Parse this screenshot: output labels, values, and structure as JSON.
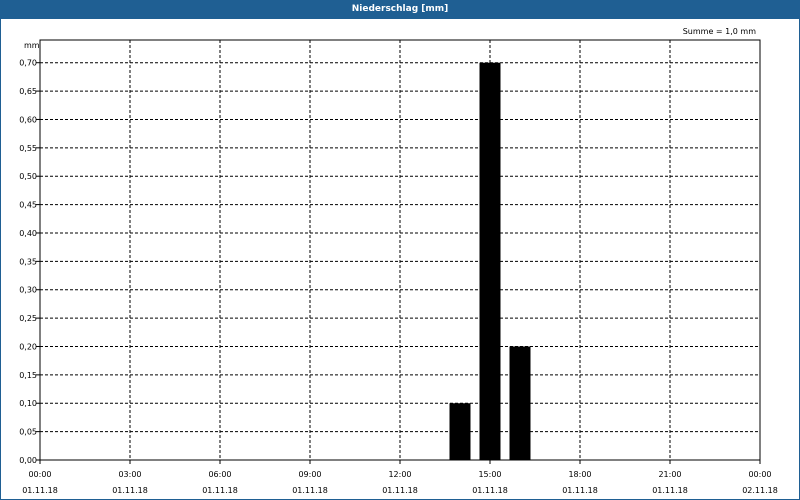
{
  "window": {
    "title": "Niederschlag [mm]"
  },
  "summary": {
    "text": "Summe = 1,0 mm"
  },
  "colors": {
    "titlebar": "#1f5f93",
    "bars": "#000000",
    "grid": "#000000"
  },
  "chart_data": {
    "type": "bar",
    "title": "Niederschlag [mm]",
    "ylabel": "mm",
    "ylim": [
      0,
      0.74
    ],
    "yticks": [
      0,
      0.05,
      0.1,
      0.15,
      0.2,
      0.25,
      0.3,
      0.35,
      0.4,
      0.45,
      0.5,
      0.55,
      0.6,
      0.65,
      0.7
    ],
    "ytick_labels": [
      "0,00",
      "0,05",
      "0,10",
      "0,15",
      "0,20",
      "0,25",
      "0,30",
      "0,35",
      "0,40",
      "0,45",
      "0,50",
      "0,55",
      "0,60",
      "0,65",
      "0,70"
    ],
    "xlim": [
      "01.11.18 00:00",
      "02.11.18 00:00"
    ],
    "x_ticks": [
      {
        "time": "00:00",
        "date": "01.11.18"
      },
      {
        "time": "03:00",
        "date": "01.11.18"
      },
      {
        "time": "06:00",
        "date": "01.11.18"
      },
      {
        "time": "09:00",
        "date": "01.11.18"
      },
      {
        "time": "12:00",
        "date": "01.11.18"
      },
      {
        "time": "15:00",
        "date": "01.11.18"
      },
      {
        "time": "18:00",
        "date": "01.11.18"
      },
      {
        "time": "21:00",
        "date": "01.11.18"
      },
      {
        "time": "00:00",
        "date": "02.11.18"
      }
    ],
    "bars": [
      {
        "hour": "14:00",
        "value": 0.1
      },
      {
        "hour": "15:00",
        "value": 0.7
      },
      {
        "hour": "16:00",
        "value": 0.2
      }
    ],
    "grid": true,
    "summary": "Summe = 1,0 mm"
  }
}
